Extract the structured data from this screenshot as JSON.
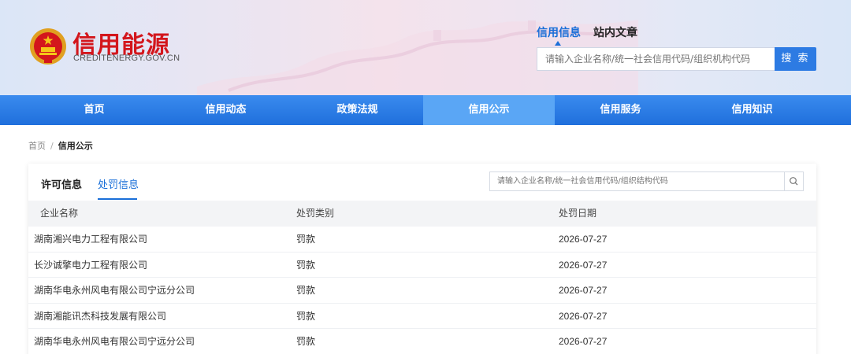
{
  "site": {
    "title": "信用能源",
    "subtitle": "CREDITENERGY.GOV.CN"
  },
  "header_search": {
    "tabs": [
      {
        "label": "信用信息",
        "active": true
      },
      {
        "label": "站内文章",
        "active": false
      }
    ],
    "placeholder": "请输入企业名称/统一社会信用代码/组织机构代码",
    "button_label": "搜 索"
  },
  "nav": {
    "items": [
      {
        "label": "首页",
        "active": false
      },
      {
        "label": "信用动态",
        "active": false
      },
      {
        "label": "政策法规",
        "active": false
      },
      {
        "label": "信用公示",
        "active": true
      },
      {
        "label": "信用服务",
        "active": false
      },
      {
        "label": "信用知识",
        "active": false
      }
    ]
  },
  "breadcrumb": {
    "home": "首页",
    "separator": "/",
    "current": "信用公示"
  },
  "panel": {
    "tabs": [
      {
        "label": "许可信息",
        "active": false
      },
      {
        "label": "处罚信息",
        "active": true
      }
    ],
    "search_placeholder": "请输入企业名称/统一社会信用代码/组织结构代码",
    "columns": [
      "企业名称",
      "处罚类别",
      "处罚日期"
    ],
    "rows": [
      {
        "name": "湖南湘兴电力工程有限公司",
        "type": "罚款",
        "date": "2026-07-27"
      },
      {
        "name": "长沙诚擎电力工程有限公司",
        "type": "罚款",
        "date": "2026-07-27"
      },
      {
        "name": "湖南华电永州风电有限公司宁远分公司",
        "type": "罚款",
        "date": "2026-07-27"
      },
      {
        "name": "湖南湘能讯杰科技发展有限公司",
        "type": "罚款",
        "date": "2026-07-27"
      },
      {
        "name": "湖南华电永州风电有限公司宁远分公司",
        "type": "罚款",
        "date": "2026-07-27"
      }
    ]
  },
  "colors": {
    "brand_red": "#d3161c",
    "accent_blue": "#1a6fd8",
    "nav_blue": "#2a7ce6",
    "nav_active": "#5aa6f5"
  },
  "icons": {
    "emblem": "national-emblem-icon",
    "search": "search-icon"
  }
}
